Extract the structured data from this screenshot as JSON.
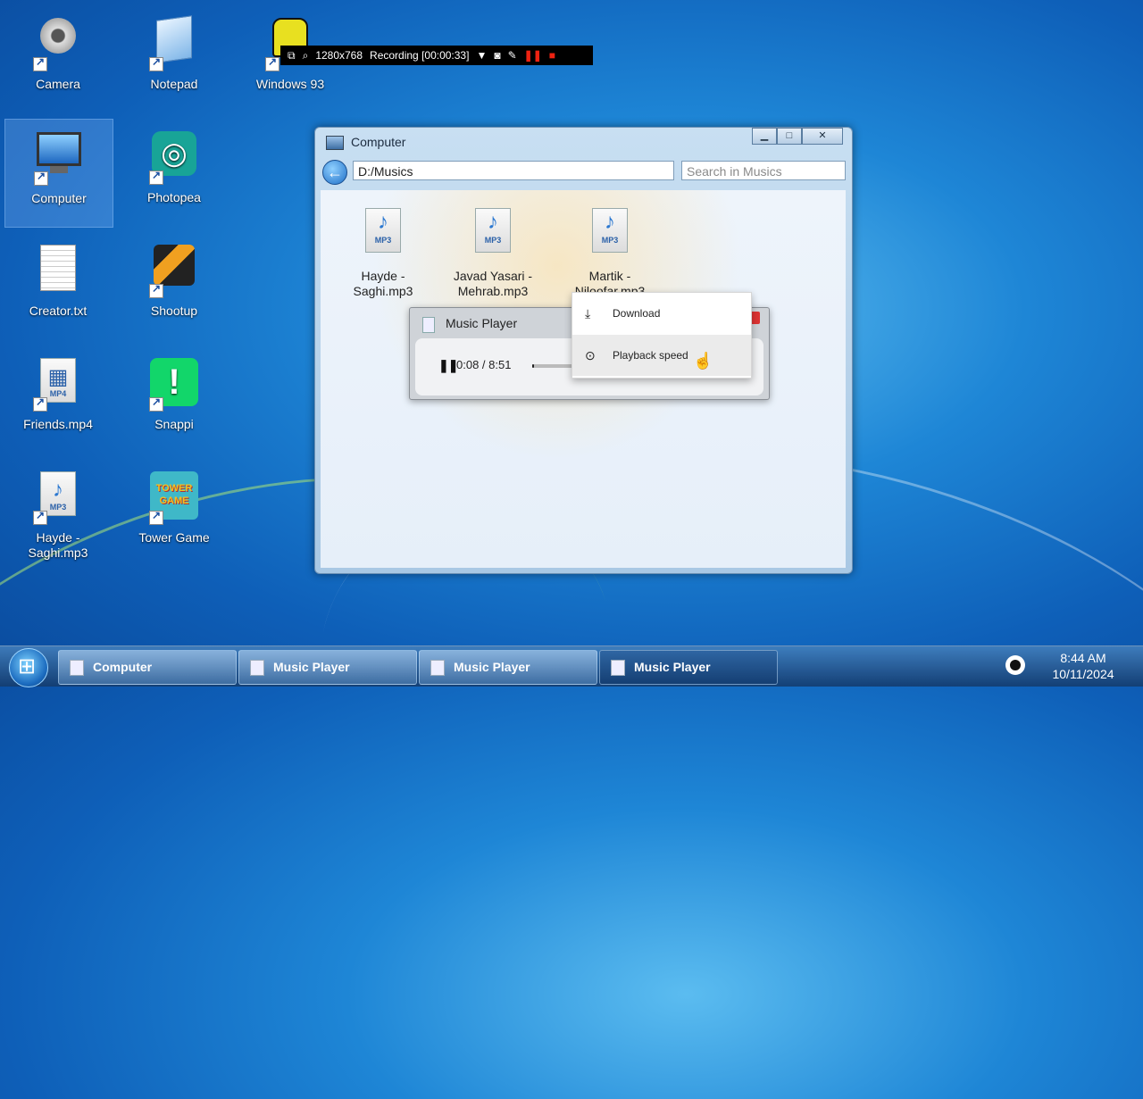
{
  "desktop": {
    "icons": [
      {
        "label": "Camera"
      },
      {
        "label": "Notepad"
      },
      {
        "label": "Windows 93"
      },
      {
        "label": "Computer"
      },
      {
        "label": "Photopea"
      },
      {
        "label": "Creator.txt"
      },
      {
        "label": "Shootup"
      },
      {
        "label": "Friends.mp4"
      },
      {
        "label": "Snappi"
      },
      {
        "label": "Hayde - Saghi.mp3"
      },
      {
        "label": "Tower Game"
      }
    ]
  },
  "recorder": {
    "resolution": "1280x768",
    "status": "Recording [00:00:33]"
  },
  "explorer": {
    "title": "Computer",
    "address": "D:/Musics",
    "search_placeholder": "Search in Musics",
    "files": [
      {
        "label": "Hayde - Saghi.mp3",
        "ext": "MP3"
      },
      {
        "label": "Javad Yasari - Mehrab.mp3",
        "ext": "MP3"
      },
      {
        "label": "Martik - Niloofar.mp3",
        "ext": "MP3"
      }
    ]
  },
  "music_player": {
    "title": "Music Player",
    "time": "0:08 / 8:51",
    "progress": 0.015
  },
  "context_menu": {
    "items": [
      {
        "label": "Download"
      },
      {
        "label": "Playback speed"
      }
    ]
  },
  "taskbar": {
    "tasks": [
      {
        "label": "Computer"
      },
      {
        "label": "Music Player"
      },
      {
        "label": "Music Player"
      },
      {
        "label": "Music Player"
      }
    ],
    "time": "8:44 AM",
    "date": "10/11/2024"
  }
}
